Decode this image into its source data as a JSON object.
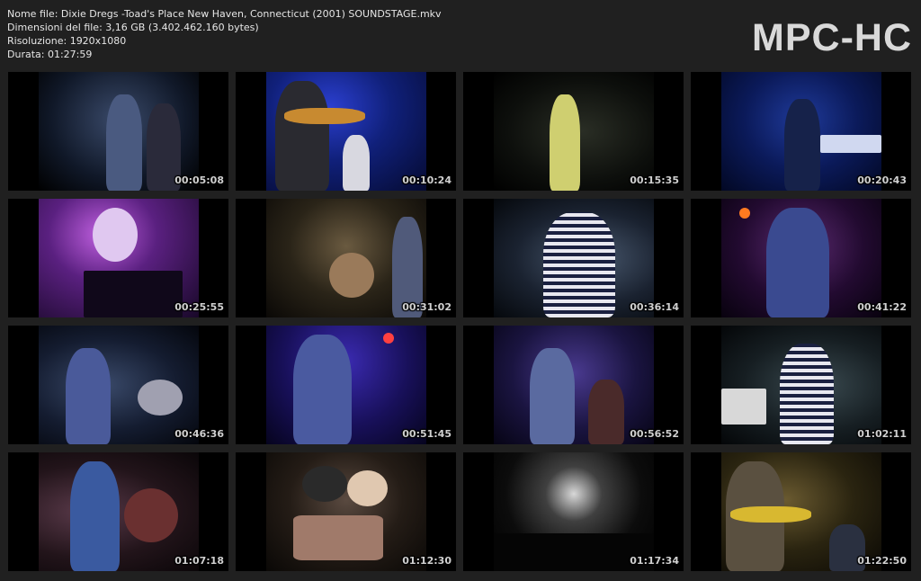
{
  "header": {
    "file_name": "Nome file: Dixie Dregs -Toad's Place New Haven, Connecticut (2001) SOUNDSTAGE.mkv",
    "file_size": "Dimensioni del file: 3,16 GB (3.402.462.160 bytes)",
    "resolution": "Risoluzione: 1920x1080",
    "duration": "Durata: 01:27:59"
  },
  "logo": "MPC-HC",
  "thumbnails": [
    {
      "time": "00:05:08"
    },
    {
      "time": "00:10:24"
    },
    {
      "time": "00:15:35"
    },
    {
      "time": "00:20:43"
    },
    {
      "time": "00:25:55"
    },
    {
      "time": "00:31:02"
    },
    {
      "time": "00:36:14"
    },
    {
      "time": "00:41:22"
    },
    {
      "time": "00:46:36"
    },
    {
      "time": "00:51:45"
    },
    {
      "time": "00:56:52"
    },
    {
      "time": "01:02:11"
    },
    {
      "time": "01:07:18"
    },
    {
      "time": "01:12:30"
    },
    {
      "time": "01:17:34"
    },
    {
      "time": "01:22:50"
    }
  ],
  "colors": {
    "background": "#202020",
    "text": "#e6e6e6",
    "logo": "#d9d9d9"
  }
}
